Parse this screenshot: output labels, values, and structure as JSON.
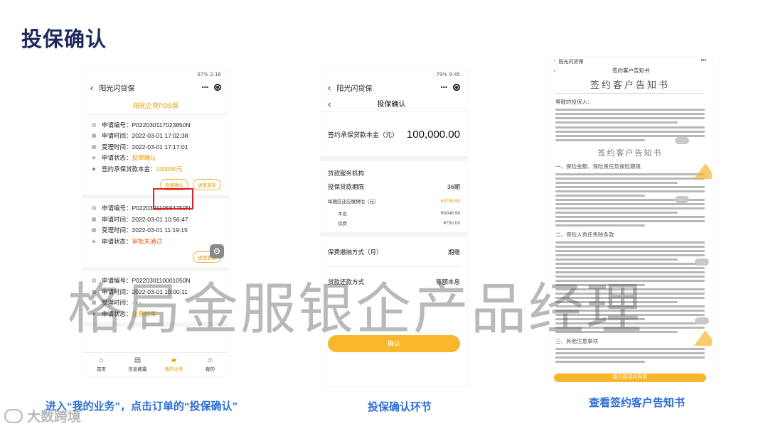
{
  "slide": {
    "title": "投保确认",
    "captions": [
      "进入“我的业务”，点击订单的“投保确认”",
      "投保确认环节",
      "查看签约客户告知书"
    ],
    "watermark": "格局金服银企产品经理",
    "logo_text": "大数跨境"
  },
  "phone1": {
    "statusbar": "67% 2:16",
    "nav_title": "阳光闪贷保",
    "nav_dots": "•••",
    "tab_title": "阳光企贷POS保",
    "orders": [
      {
        "rows": [
          {
            "icon": "doc-icon",
            "label": "申请编号：",
            "value": "P022030117023850N"
          },
          {
            "icon": "calendar-icon",
            "label": "申请时间：",
            "value": "2022-03-01 17:02:38"
          },
          {
            "icon": "calendar-icon",
            "label": "受理时间：",
            "value": "2022-03-01 17:17:01"
          },
          {
            "icon": "status-icon",
            "label": "申请状态：",
            "value": "投保确认",
            "color": "#e89a00"
          },
          {
            "icon": "money-icon",
            "label": "签约承保贷款本金：",
            "value": "100000元",
            "color": "#e89a00"
          }
        ],
        "buttons": [
          "投保确认",
          "进度查看"
        ]
      },
      {
        "rows": [
          {
            "icon": "doc-icon",
            "label": "申请编号：",
            "value": "P022030110564750N"
          },
          {
            "icon": "calendar-icon",
            "label": "申请时间：",
            "value": "2022-03-01 10:56:47"
          },
          {
            "icon": "calendar-icon",
            "label": "受理时间：",
            "value": "2022-03-01 11:19:15"
          },
          {
            "icon": "status-icon",
            "label": "申请状态：",
            "value": "审批未通过",
            "color": "#e05a2b"
          }
        ],
        "buttons": [
          "进度查看"
        ]
      },
      {
        "rows": [
          {
            "icon": "doc-icon",
            "label": "申请编号：",
            "value": "P022030110001050N"
          },
          {
            "icon": "calendar-icon",
            "label": "申请时间：",
            "value": "2022-03-01 10:00:11"
          },
          {
            "icon": "calendar-icon",
            "label": "受理时间：",
            "value": "- - -"
          },
          {
            "icon": "status-icon",
            "label": "申请状态：",
            "value": "业务结束",
            "color": "#e89a00"
          }
        ],
        "buttons": []
      }
    ],
    "tabs": [
      {
        "icon": "home-icon",
        "label": "首页",
        "active": false
      },
      {
        "icon": "info-icon",
        "label": "信息披露",
        "active": false
      },
      {
        "icon": "briefcase-icon",
        "label": "我的业务",
        "active": true
      },
      {
        "icon": "user-icon",
        "label": "我的",
        "active": false
      }
    ]
  },
  "phone2": {
    "statusbar": "79% 9:45",
    "nav_title": "阳光闪贷保",
    "page_title": "投保确认",
    "amount_label": "签约承保贷款本金（元）",
    "amount_value": "100,000.00",
    "org_label": "贷款服务机构",
    "term_label": "投保贷款期限",
    "term_value": "36期",
    "monthly_label": "每期应还应缴预估（元）",
    "monthly_value": "¥3798.99",
    "interest_label": "本息",
    "interest_value": "¥3048.99",
    "premium_label": "保费",
    "premium_value": "¥750.00",
    "pay_method_label": "保费缴纳方式（月）",
    "pay_method_value": "期缴",
    "repay_label": "贷款还款方式",
    "repay_value": "等额本息",
    "confirm_label": "确认"
  },
  "phone3": {
    "nav_title": "阳光闪贷保",
    "page_title": "签约客户告知书",
    "notice_title": "签约客户告知书",
    "notice_title2": "签约客户告知书",
    "salutation": "尊敬的投保人：",
    "section1": "一、保险金额、保险责任及保险期限",
    "section2": "二、保险人责任免除条款",
    "section3": "三、其他注意事项",
    "agree_label": "我已阅读并同意"
  }
}
